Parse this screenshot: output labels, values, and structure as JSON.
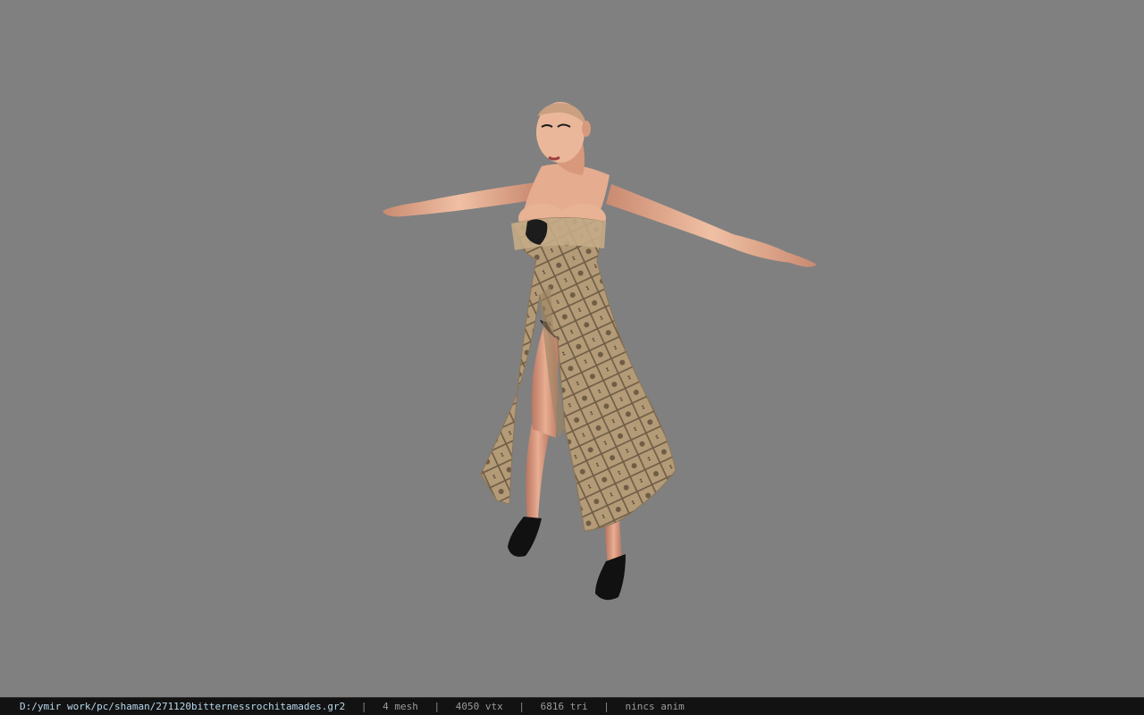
{
  "status_bar": {
    "file_path": "D:/ymir work/pc/shaman/271120bitternessrochitamades.gr2",
    "separator": "|",
    "mesh_count": "4 mesh",
    "vertex_count": "4050 vtx",
    "triangle_count": "6816 tri",
    "animation": "nincs anim"
  },
  "colors": {
    "viewport_background": "#808080",
    "status_background": "#121212",
    "status_path_text": "#b8d8ec",
    "status_text": "#9a9a9a",
    "dress": "#b49b78",
    "skin": "#e6ac90",
    "shoes": "#111111"
  }
}
